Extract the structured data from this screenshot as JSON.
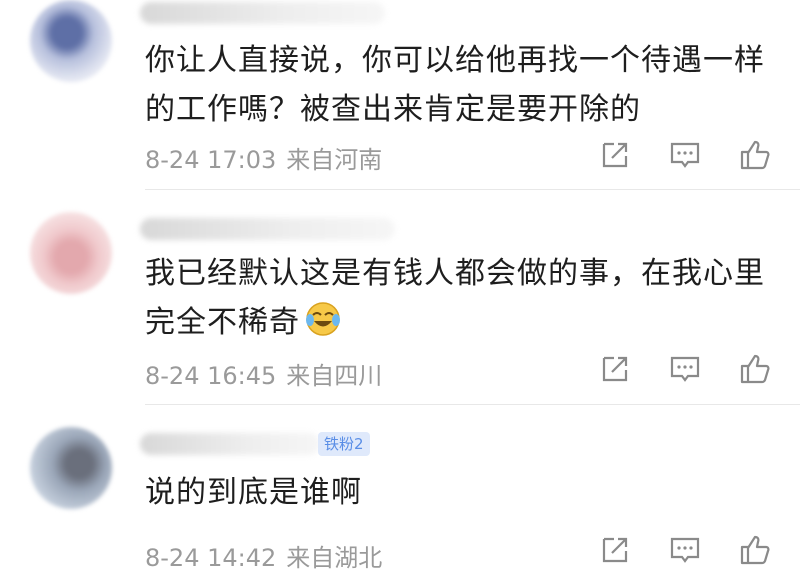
{
  "comments": [
    {
      "text_line1": "你让人直接说，你可以给他再找一个待遇一样",
      "text_line2": "的工作嗎？被查出来肯定是要开除的",
      "time": "8-24 17:03",
      "location": "来自河南"
    },
    {
      "text_line1": "我已经默认这是有钱人都会做的事，在我心里",
      "text_line2": "完全不稀奇",
      "emoji": "laugh-cry-emoji",
      "time": "8-24 16:45",
      "location": "来自四川"
    },
    {
      "badge": "铁粉2",
      "text_line1": "说的到底是谁啊",
      "time": "8-24 14:42",
      "location": "来自湖北"
    }
  ],
  "icons": {
    "share": "share-icon",
    "reply": "comment-icon",
    "like": "like-icon"
  },
  "colors": {
    "text": "#1e1e1e",
    "meta": "#9a9a9a",
    "badge_bg": "#dfe9fb",
    "badge_text": "#5a8ee6"
  }
}
